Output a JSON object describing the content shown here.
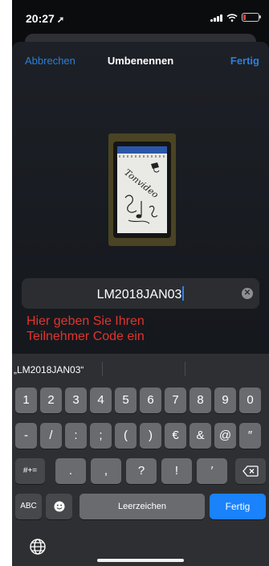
{
  "status": {
    "time": "20:27",
    "location_icon": "location-arrow-icon",
    "battery_color": "#ff3b30"
  },
  "nav": {
    "cancel": "Abbrechen",
    "title": "Umbenennen",
    "done": "Fertig"
  },
  "image": {
    "handwriting": "Tonvideo"
  },
  "name_field": {
    "value": "LM2018JAN03"
  },
  "hint": {
    "line1": "Hier geben Sie Ihren",
    "line2": "Teilnehmer Code ein"
  },
  "keyboard": {
    "suggestion": "„LM2018JAN03“",
    "row1": [
      "1",
      "2",
      "3",
      "4",
      "5",
      "6",
      "7",
      "8",
      "9",
      "0"
    ],
    "row2": [
      "-",
      "/",
      ":",
      ";",
      "(",
      ")",
      "€",
      "&",
      "@",
      "″"
    ],
    "row3": [
      "#+=",
      ".",
      ",",
      "?",
      "!",
      "′",
      "delete-icon"
    ],
    "abc": "ABC",
    "emoji_icon": "emoji-icon",
    "space": "Leerzeichen",
    "return": "Fertig",
    "globe_icon": "globe-icon"
  },
  "colors": {
    "accent": "#2c7fd9",
    "hint": "#e1342d",
    "return_key": "#1a82fb"
  }
}
